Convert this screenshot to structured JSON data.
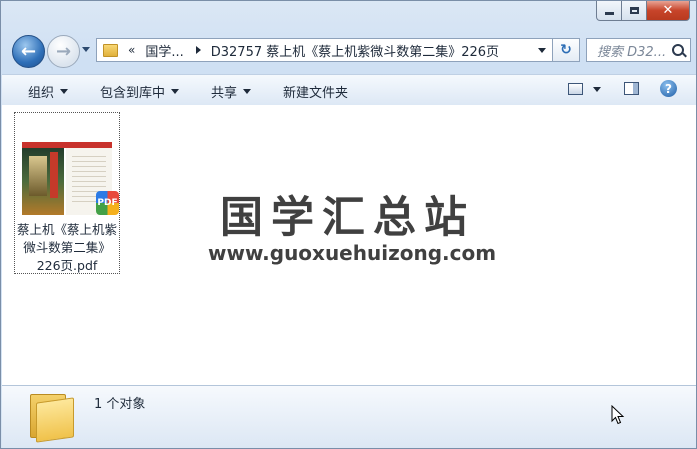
{
  "window": {
    "caption": {
      "minimize": "—",
      "maximize": "□",
      "close": "✕"
    }
  },
  "nav": {
    "back_glyph": "←",
    "forward_glyph": "→",
    "address": {
      "overflow": "«",
      "crumbs": [
        "国学...",
        "D32757 蔡上机《蔡上机紫微斗数第二集》226页"
      ]
    },
    "refresh_glyph": "↻",
    "search_placeholder": "搜索 D32..."
  },
  "commands": {
    "organize": "组织",
    "include_library": "包含到库中",
    "share": "共享",
    "new_folder": "新建文件夹",
    "help": "?"
  },
  "files": [
    {
      "name": "蔡上机《蔡上机紫微斗数第二集》226页.pdf",
      "name_lines": [
        "蔡上机《蔡上机紫",
        "微斗数第二集》",
        "226页.pdf"
      ],
      "badge": "PDF",
      "icon": "pdf-thumbnail-icon"
    }
  ],
  "watermark": {
    "title": "国学汇总站",
    "url": "www.guoxuehuizong.com"
  },
  "status": {
    "count": "1 个对象"
  },
  "colors": {
    "accent": "#2e6fb8",
    "close": "#c7442a",
    "chrome": "#dbe7f5"
  }
}
